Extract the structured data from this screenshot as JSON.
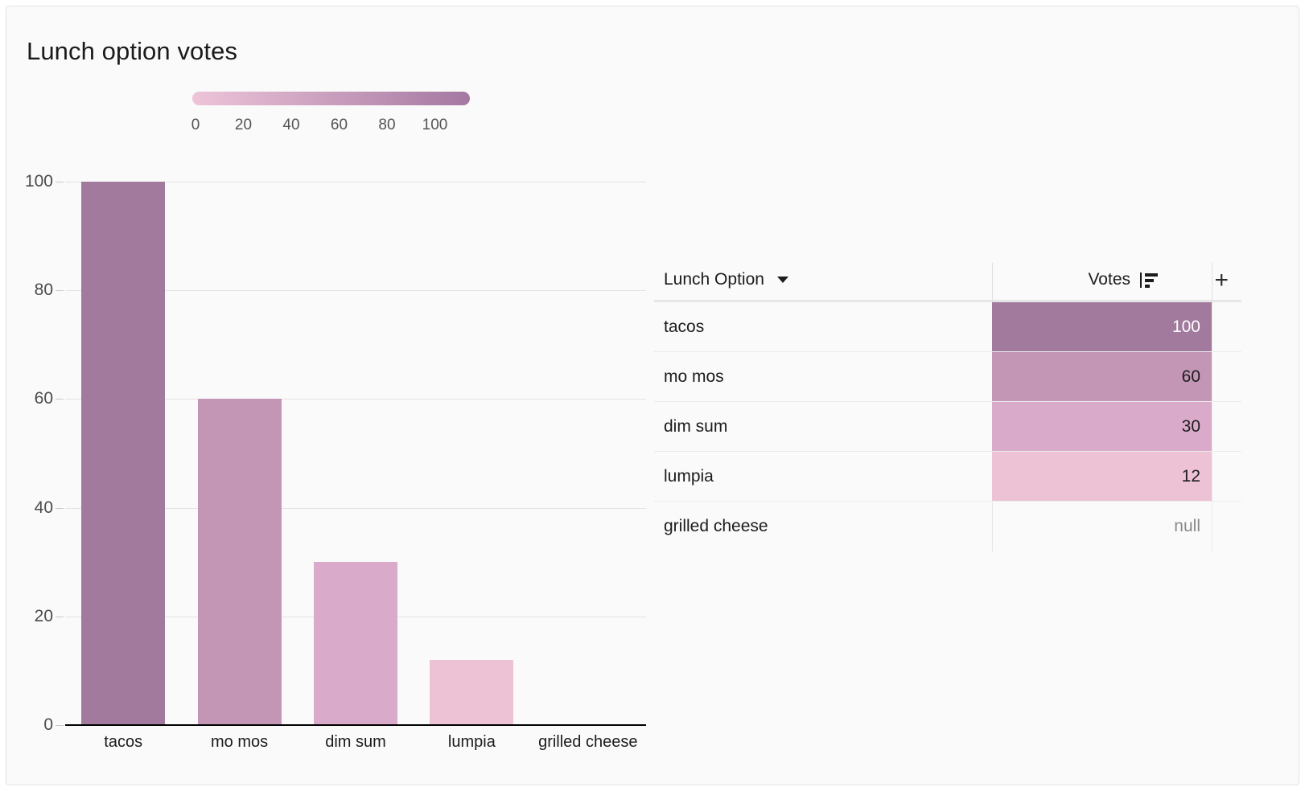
{
  "title": "Lunch option votes",
  "legend": {
    "ticks": [
      "0",
      "20",
      "40",
      "60",
      "80",
      "100"
    ],
    "gradient_start": "#eec4d9",
    "gradient_end": "#a478a1"
  },
  "table": {
    "col_option_header": "Lunch Option",
    "col_votes_header": "Votes",
    "add_column_label": "+",
    "sort_icon": "sort-descending-icon",
    "dropdown_icon": "chevron-down-icon",
    "null_label": "null",
    "rows": [
      {
        "label": "tacos",
        "value": "100",
        "fill": "#a17a9e",
        "text_color": "#ffffff"
      },
      {
        "label": "mo mos",
        "value": "60",
        "fill": "#c396b6",
        "text_color": "#1c1c1c"
      },
      {
        "label": "dim sum",
        "value": "30",
        "fill": "#d9aac9",
        "text_color": "#1c1c1c"
      },
      {
        "label": "lumpia",
        "value": "12",
        "fill": "#edc2d5",
        "text_color": "#1c1c1c"
      },
      {
        "label": "grilled cheese",
        "value": "null",
        "fill": "none",
        "text_color": "#8a8a8a"
      }
    ]
  },
  "chart_data": {
    "type": "bar",
    "title": "Lunch option votes",
    "xlabel": "",
    "ylabel": "",
    "categories": [
      "tacos",
      "mo mos",
      "dim sum",
      "lumpia",
      "grilled cheese"
    ],
    "values": [
      100,
      60,
      30,
      12,
      null
    ],
    "bar_colors": [
      "#a17a9e",
      "#c396b6",
      "#d9aac9",
      "#edc2d5",
      "none"
    ],
    "ylim": [
      0,
      100
    ],
    "yticks": [
      0,
      20,
      40,
      60,
      80,
      100
    ],
    "ytick_labels": [
      "0",
      "20",
      "40",
      "60",
      "80",
      "100"
    ],
    "grid": true,
    "legend": {
      "type": "continuous-colorbar",
      "position": "top",
      "domain": [
        0,
        100
      ],
      "ticks": [
        0,
        20,
        40,
        60,
        80,
        100
      ]
    }
  }
}
